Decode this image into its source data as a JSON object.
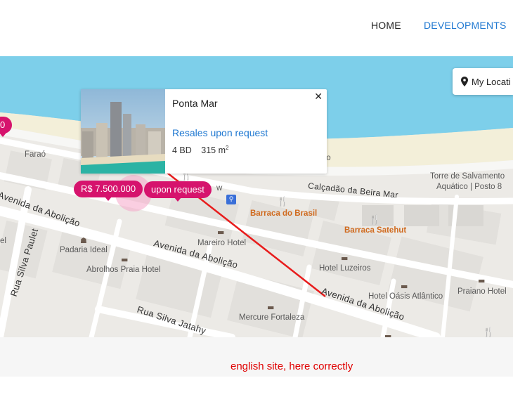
{
  "nav": {
    "items": [
      {
        "label": "HOME"
      },
      {
        "label": "DEVELOPMENTS",
        "active": true
      }
    ],
    "active_color": "#1f78d1"
  },
  "map": {
    "my_location_label": "My Locati",
    "popup": {
      "title": "Ponta Mar",
      "close_glyph": "✕",
      "link_text": "Resales upon request",
      "bedrooms": "4 BD",
      "area_value": "315 m",
      "area_sup": "2"
    },
    "markers": [
      {
        "label": "R$ 7.500.000"
      },
      {
        "label": "upon request"
      },
      {
        "label": "0"
      }
    ],
    "labels": {
      "farao": "Faraó",
      "torre1": "Torre de Salvamento",
      "torre2": "Aquático | Posto 8",
      "calcadao": "Calçadão da Beira Mar",
      "barraca_brasil": "Barraca do Brasil",
      "barraca_satehut": "Barraca Satehut",
      "padaria": "Padaria Ideal",
      "mareiro": "Mareiro Hotel",
      "luzeiros": "Hotel Luzeiros",
      "oasis": "Hotel Oásis Atlântico",
      "praiano": "Praiano Hotel",
      "abrolhos": "Abrolhos Praia Hotel",
      "mercure": "Mercure Fortaleza",
      "av_abolicao": "Avenida da Abolição",
      "rua_paulet": "Rua Silva Paulet",
      "rua_jatahy": "Rua Silva Jatahy",
      "fragment_to": "to",
      "fragment_el": "el",
      "fragment_w": "w"
    },
    "colors": {
      "water": "#7dcfea",
      "sand": "#f3efd9",
      "land": "#eceae6",
      "marker": "#d6136d",
      "arrow": "#e81c1c"
    }
  },
  "footer": {
    "note": "english site, here correctly"
  }
}
